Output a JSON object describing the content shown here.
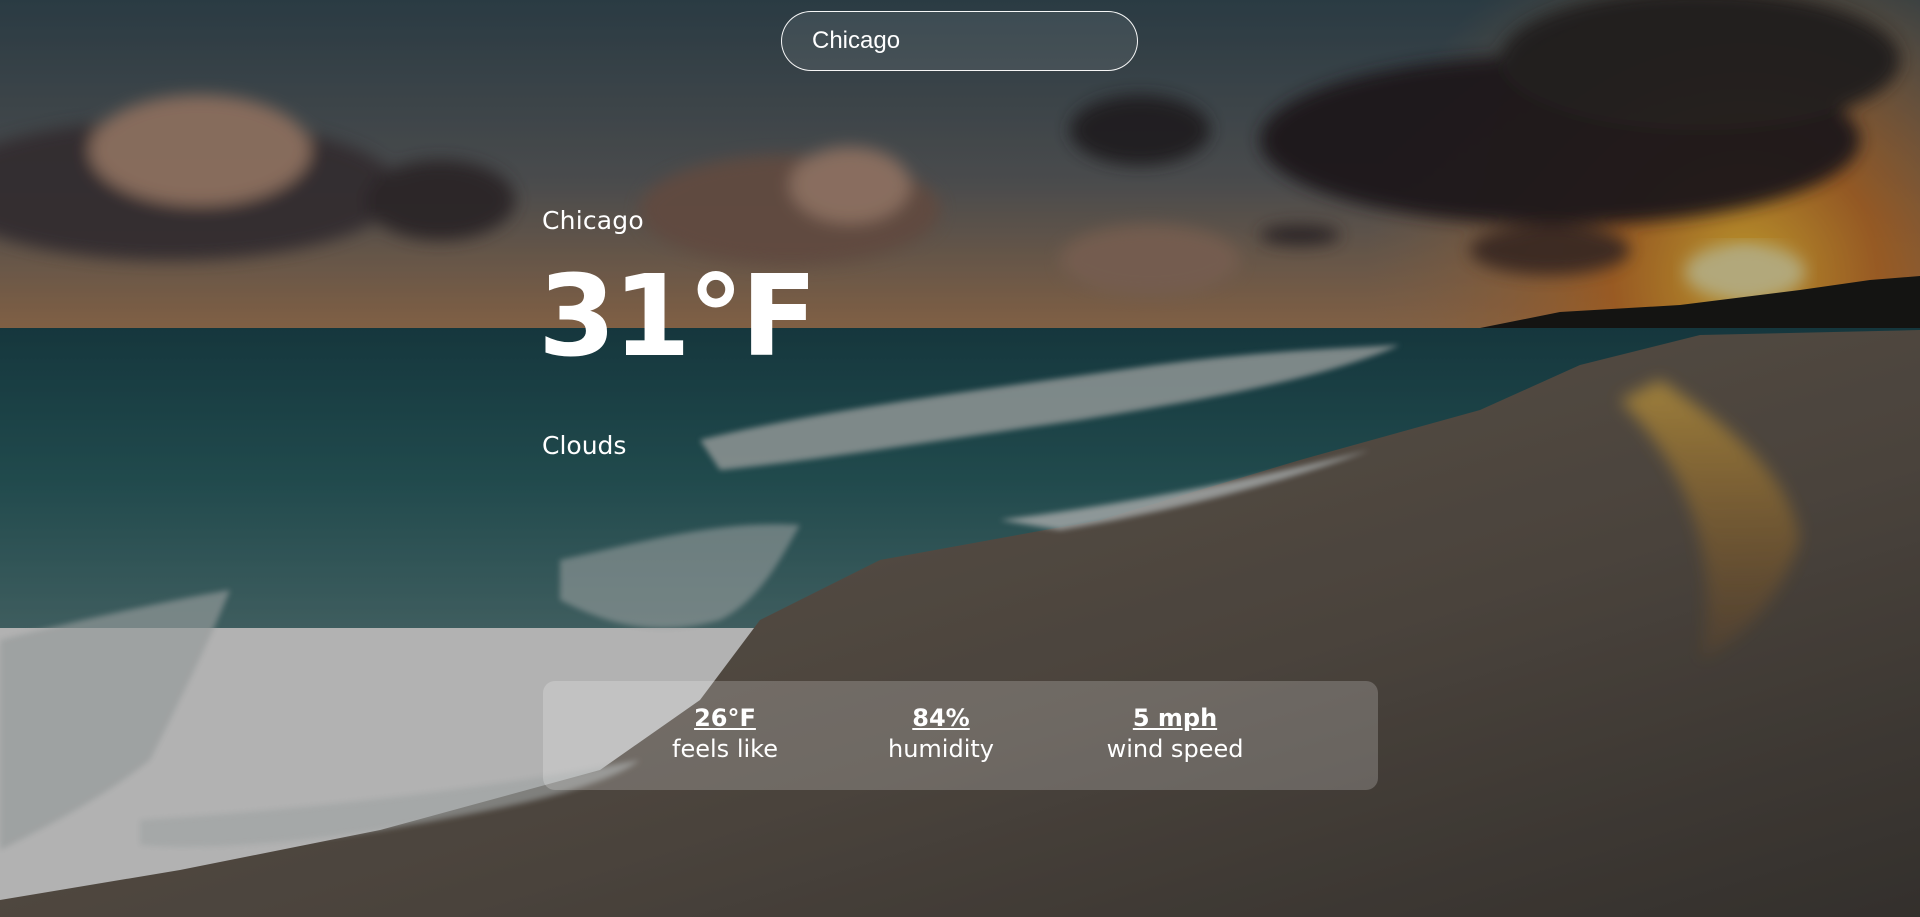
{
  "search": {
    "value": "Chicago",
    "placeholder": ""
  },
  "weather": {
    "location": "Chicago",
    "temperature": "31°F",
    "description": "Clouds"
  },
  "stats": {
    "feels_like": {
      "value": "26°F",
      "label": "feels like"
    },
    "humidity": {
      "value": "84%",
      "label": "humidity"
    },
    "wind_speed": {
      "value": "5 mph",
      "label": "wind speed"
    }
  },
  "background": {
    "scene": "beach-sunset-photo",
    "colors": {
      "sky_top": "#3b4f5c",
      "sunset_glow": "#f0a030",
      "ocean": "#2e5a60",
      "sand": "#6a6258",
      "overlay": "#000000"
    }
  }
}
